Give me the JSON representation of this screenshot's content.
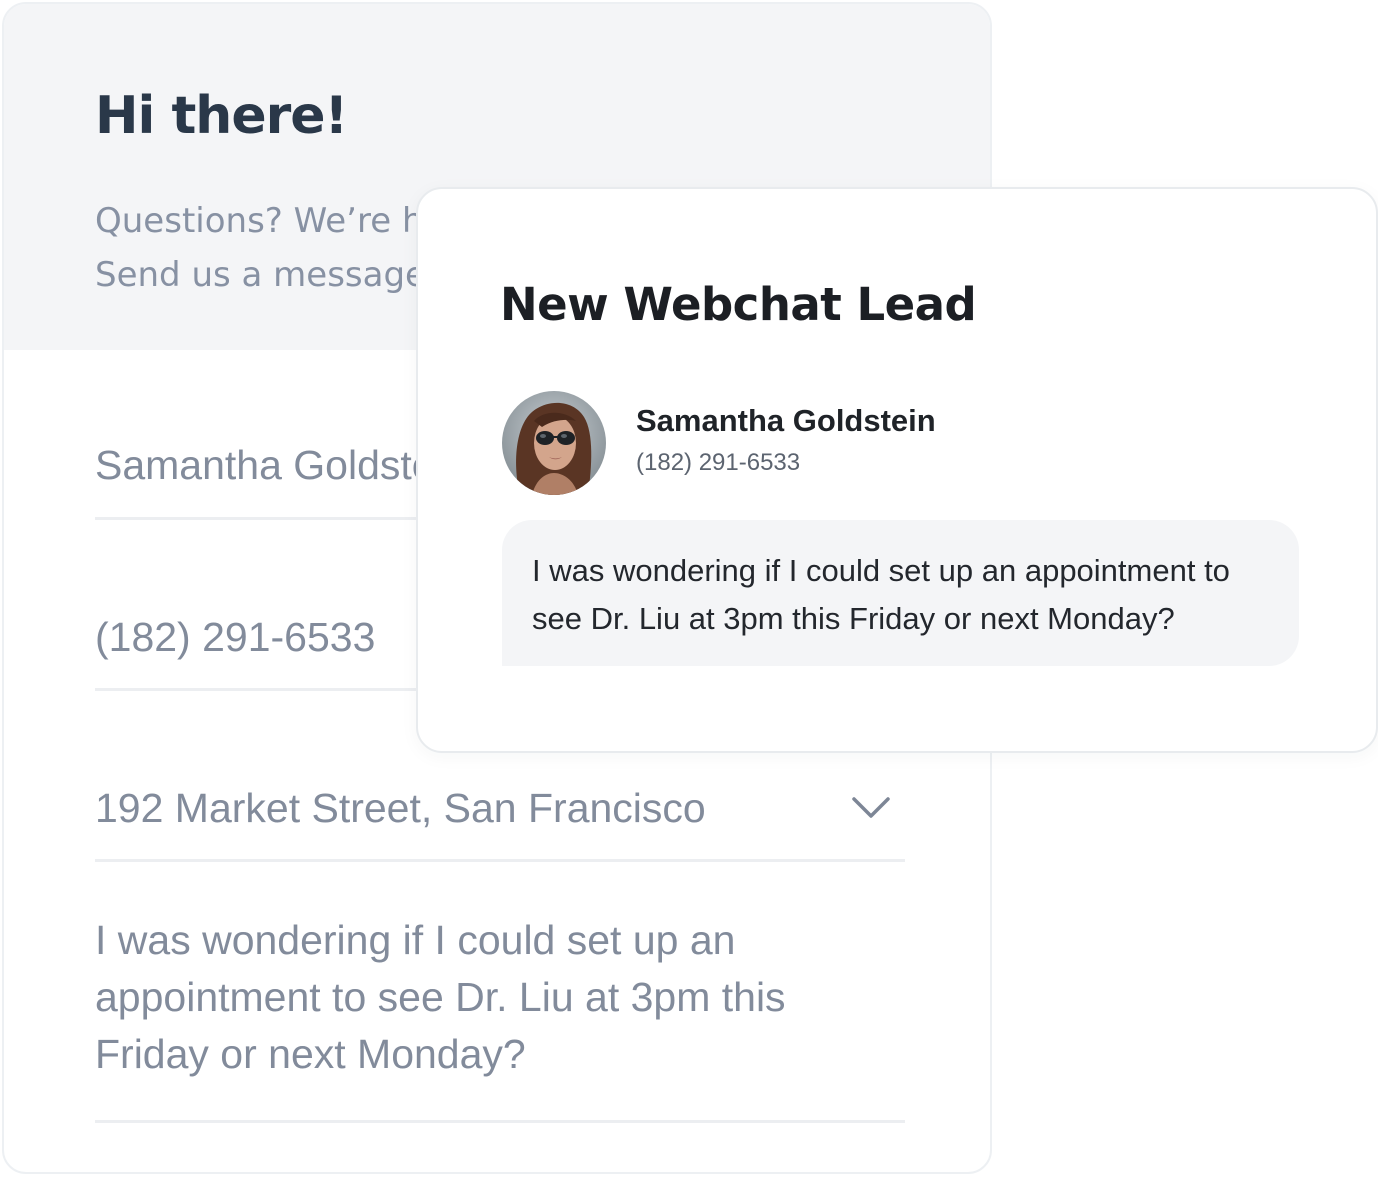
{
  "form": {
    "title": "Hi there!",
    "subtitle_line1": "Questions? We’re h",
    "subtitle_line2": "Send us a message",
    "name_value": "Samantha Goldstein",
    "phone_value": "(182) 291-6533",
    "address_value": "192 Market Street, San Francisco",
    "address_icon": "chevron-down-icon",
    "message_value": "I was wondering if I could set up an appointment to see Dr. Liu at 3pm this Friday or next Monday?"
  },
  "lead": {
    "title": "New Webchat Lead",
    "contact_name": "Samantha Goldstein",
    "contact_phone": "(182) 291-6533",
    "avatar_icon": "avatar-photo",
    "message": "I was wondering if I could set up an appointment to see Dr. Liu at 3pm this Friday or next Monday?"
  },
  "colors": {
    "header_bg": "#f4f5f7",
    "title_text": "#2a3849",
    "muted_text": "#828b9b",
    "bubble_bg": "#f4f5f7",
    "dark_text": "#1c1f24"
  }
}
